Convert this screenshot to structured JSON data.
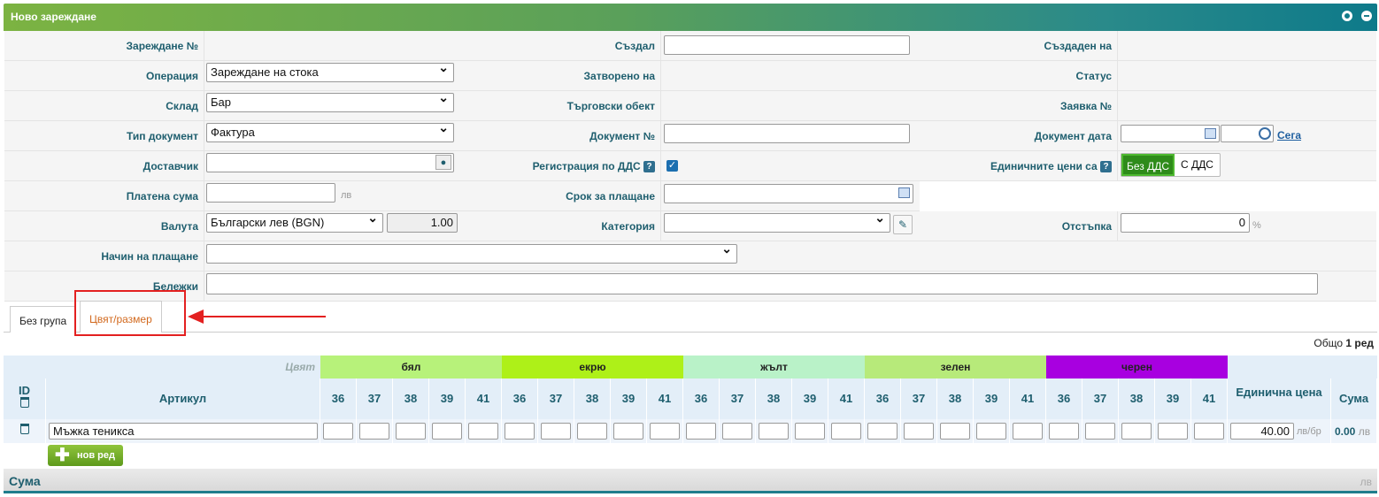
{
  "header": {
    "title": "Ново зареждане"
  },
  "form": {
    "loading_no_label": "Зареждане №",
    "created_by_label": "Създал",
    "created_on_label": "Създаден на",
    "operation_label": "Операция",
    "operation_value": "Зареждане на стока",
    "closed_on_label": "Затворено на",
    "status_label": "Статус",
    "warehouse_label": "Склад",
    "warehouse_value": "Бар",
    "trade_object_label": "Търговски обект",
    "request_no_label": "Заявка №",
    "doc_type_label": "Тип документ",
    "doc_type_value": "Фактура",
    "doc_no_label": "Документ №",
    "doc_date_label": "Документ дата",
    "now_link": "Сега",
    "supplier_label": "Доставчик",
    "vat_reg_label": "Регистрация по ДДС",
    "unit_prices_label": "Единичните цени са",
    "no_vat_btn": "Без ДДС",
    "with_vat_btn": "С ДДС",
    "paid_label": "Платена сума",
    "paid_unit": "лв",
    "due_label": "Срок за плащане",
    "currency_label": "Валута",
    "currency_value": "Български лев (BGN)",
    "rate_value": "1.00",
    "category_label": "Категория",
    "discount_label": "Отстъпка",
    "discount_value": "0",
    "discount_unit": "%",
    "payment_method_label": "Начин на плащане",
    "notes_label": "Бележки"
  },
  "tabs": [
    {
      "label": "Без група"
    },
    {
      "label": "Цвят/размер"
    }
  ],
  "table": {
    "total_prefix": "Общо",
    "total_count": "1",
    "total_suffix": "ред",
    "color_header": "Цвят",
    "colors": [
      {
        "name": "бял",
        "color": "#b7f27a"
      },
      {
        "name": "екрю",
        "color": "#aef018"
      },
      {
        "name": "жълт",
        "color": "#b9f2c8"
      },
      {
        "name": "зелен",
        "color": "#b7ea7a"
      },
      {
        "name": "черен",
        "color": "#a800e0"
      }
    ],
    "sizes": [
      "36",
      "37",
      "38",
      "39",
      "41"
    ],
    "id_header": "ID",
    "article_header": "Артикул",
    "unit_price_header": "Единична цена",
    "sum_header": "Сума",
    "rows": [
      {
        "article": "Мъжка теникса",
        "price": "40.00",
        "price_unit": "лв/бр",
        "sum": "0.00",
        "sum_unit": "лв"
      }
    ],
    "add_row": "нов ред"
  },
  "footer": {
    "sum_label": "Сума",
    "sum_unit": "лв"
  }
}
